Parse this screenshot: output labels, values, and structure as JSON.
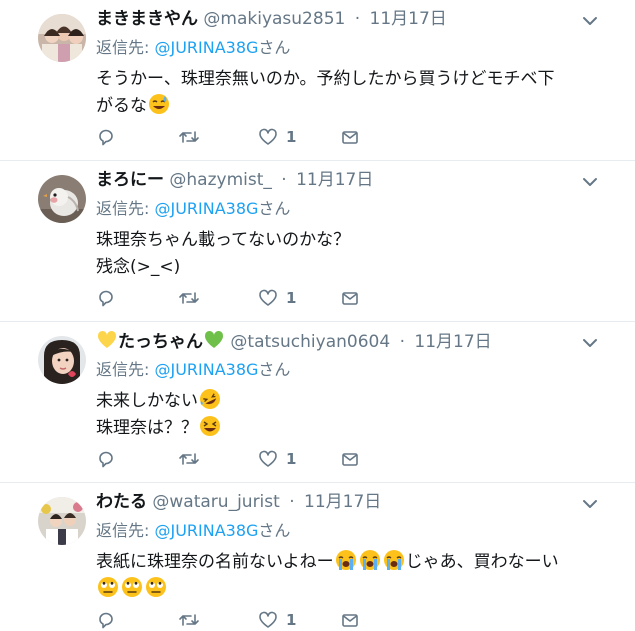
{
  "tweets": [
    {
      "name": "まきまきやん",
      "handle": "@makiyasu2851",
      "separator": "·",
      "time": "11月17日",
      "reply_prefix": "返信先: ",
      "reply_to": "@JURINA38G",
      "reply_suffix": "さん",
      "lines": [
        {
          "text": "そうかー、珠理奈無いのか。予約したから買うけどモチベ下"
        },
        {
          "text": "がるな",
          "emoji": [
            "sweat-smile"
          ]
        }
      ],
      "likes": "1",
      "avatar_icon": "user-avatar-group-photo"
    },
    {
      "name": "まろにー",
      "handle": "@hazymist_",
      "separator": "·",
      "time": "11月17日",
      "reply_prefix": "返信先: ",
      "reply_to": "@JURINA38G",
      "reply_suffix": "さん",
      "lines": [
        {
          "text": "珠理奈ちゃん載ってないのかな？"
        },
        {
          "text": "残念(>_<)"
        }
      ],
      "likes": "1",
      "avatar_icon": "user-avatar-bird"
    },
    {
      "name": "たっちゃん",
      "name_prefix_emoji": "💛",
      "name_suffix_emoji": "💚",
      "handle": "@tatsuchiyan0604",
      "separator": "·",
      "time": "11月17日",
      "reply_prefix": "返信先: ",
      "reply_to": "@JURINA38G",
      "reply_suffix": "さん",
      "lines": [
        {
          "text": "未来しかない",
          "emoji": [
            "rofl"
          ]
        },
        {
          "text": "珠理奈は？？",
          "emoji": [
            "laughing"
          ]
        }
      ],
      "likes": "1",
      "avatar_icon": "user-avatar-portrait"
    },
    {
      "name": "わたる",
      "handle": "@wataru_jurist",
      "separator": "·",
      "time": "11月17日",
      "reply_prefix": "返信先: ",
      "reply_to": "@JURINA38G",
      "reply_suffix": "さん",
      "lines": [
        {
          "text": "表紙に珠理奈の名前ないよねー",
          "emoji": [
            "crying",
            "crying",
            "crying"
          ],
          "tail": "じゃあ、買わなーい"
        },
        {
          "text": "",
          "emoji": [
            "eye-roll",
            "eye-roll",
            "eye-roll"
          ]
        }
      ],
      "likes": "1",
      "avatar_icon": "user-avatar-event"
    }
  ],
  "colors": {
    "text": "#14171a",
    "secondary": "#657786",
    "link": "#1da1f2",
    "divider": "#e6ecf0"
  },
  "icons": [
    "reply-icon",
    "retweet-icon",
    "like-icon",
    "direct-message-icon",
    "chevron-down-icon"
  ]
}
